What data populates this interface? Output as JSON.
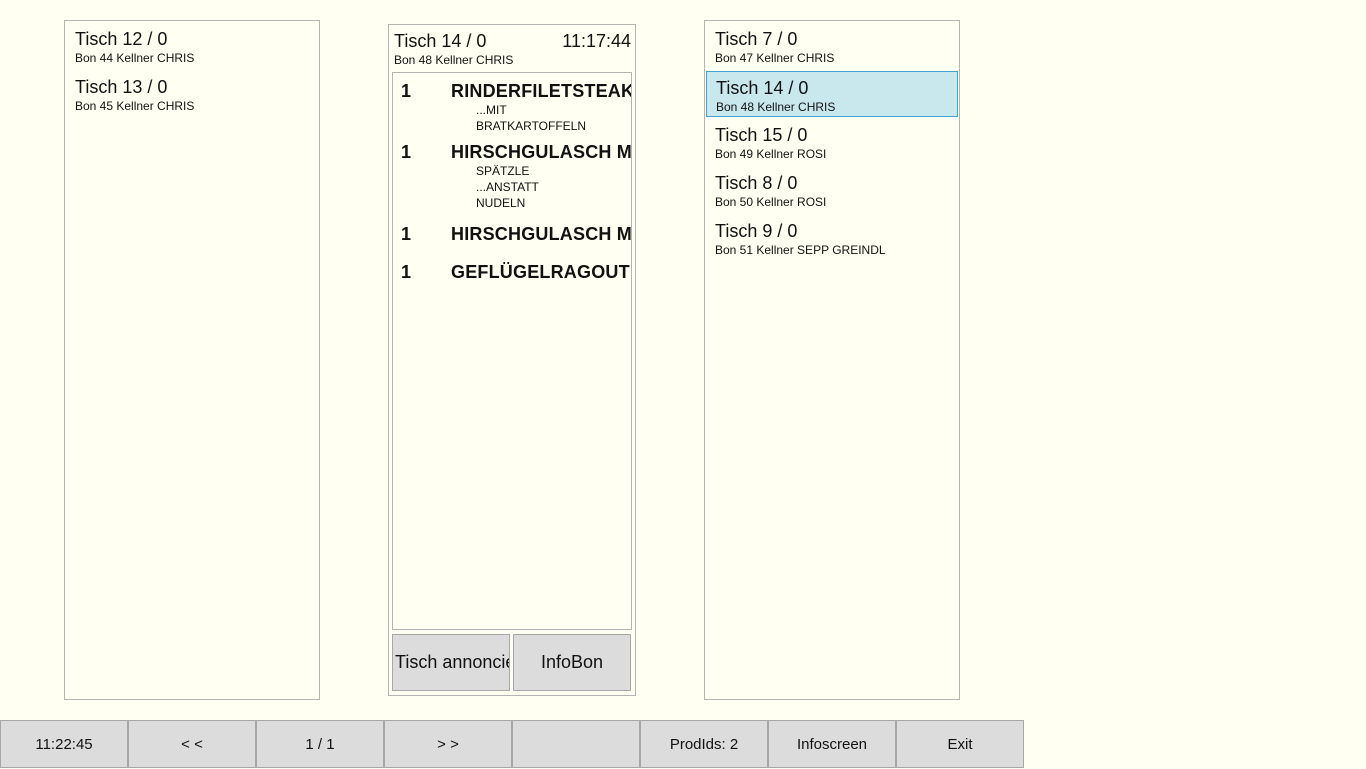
{
  "left_panel": {
    "tickets": [
      {
        "title": "Tisch 12 / 0",
        "sub": "Bon 44 Kellner CHRIS"
      },
      {
        "title": "Tisch 13 / 0",
        "sub": "Bon 45 Kellner CHRIS"
      }
    ]
  },
  "center_panel": {
    "title": "Tisch 14 / 0",
    "time": "11:17:44",
    "sub": "Bon 48 Kellner CHRIS",
    "items": [
      {
        "qty": "1",
        "name": "RINDERFILETSTEAK",
        "mods": [
          "...MIT",
          "BRATKARTOFFELN"
        ]
      },
      {
        "qty": "1",
        "name": "HIRSCHGULASCH MIT",
        "mods": [
          "SPÄTZLE",
          "...ANSTATT",
          "NUDELN"
        ]
      },
      {
        "qty": "1",
        "name": "HIRSCHGULASCH MIT",
        "mods": []
      },
      {
        "qty": "1",
        "name": "GEFLÜGELRAGOUT",
        "mods": []
      }
    ],
    "btn_annonce": "Tisch annoncieren",
    "btn_infobon": "InfoBon"
  },
  "right_panel": {
    "selected_index": 1,
    "tickets": [
      {
        "title": "Tisch 7 / 0",
        "sub": "Bon 47 Kellner CHRIS"
      },
      {
        "title": "Tisch 14 / 0",
        "sub": "Bon 48 Kellner CHRIS"
      },
      {
        "title": "Tisch 15 / 0",
        "sub": "Bon 49 Kellner ROSI"
      },
      {
        "title": "Tisch 8 / 0",
        "sub": "Bon 50 Kellner ROSI"
      },
      {
        "title": "Tisch 9 / 0",
        "sub": "Bon 51 Kellner SEPP GREINDL"
      }
    ]
  },
  "bottom_bar": {
    "clock": "11:22:45",
    "prev": "< <",
    "page": "1 / 1",
    "next": "> >",
    "empty": "",
    "prodids": "ProdIds: 2",
    "infoscreen": "Infoscreen",
    "exit": "Exit"
  },
  "colors": {
    "background": "#fffff2",
    "selected_bg": "#c9e8ee",
    "selected_border": "#3ea3d6",
    "button_bg": "#dcdcdc"
  }
}
